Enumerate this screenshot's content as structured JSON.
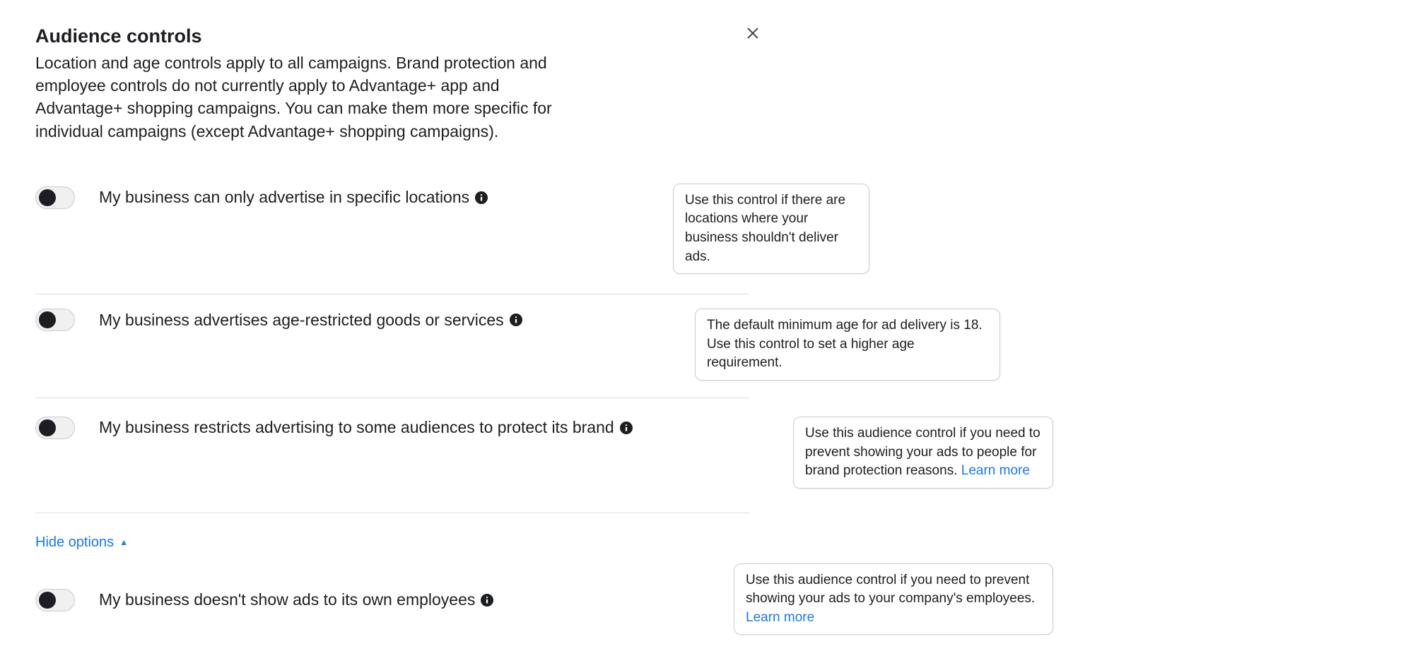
{
  "header": {
    "title": "Audience controls",
    "description": "Location and age controls apply to all campaigns. Brand protection and employee controls do not currently apply to Advantage+ app and Advantage+ shopping campaigns. You can make them more specific for individual campaigns (except Advantage+ shopping campaigns)."
  },
  "hide_options_label": "Hide options",
  "learn_more_label": "Learn more",
  "controls": [
    {
      "label": "My business can only advertise in specific locations",
      "on": false,
      "callout": "Use this control if there are locations where your business shouldn't deliver ads.",
      "has_learn_more": false
    },
    {
      "label": "My business advertises age-restricted goods or services",
      "on": false,
      "callout": "The default minimum age for ad delivery is 18. Use this control to set a higher age requirement.",
      "has_learn_more": false
    },
    {
      "label": "My business restricts advertising to some audiences to protect its brand",
      "on": false,
      "callout": "Use this audience control if you need to prevent showing your ads to people for brand protection reasons.",
      "has_learn_more": true
    },
    {
      "label": "My business doesn't show ads to its own employees",
      "on": false,
      "callout": "Use this audience control if you need to prevent showing your ads to your company's employees.",
      "has_learn_more": true
    }
  ]
}
